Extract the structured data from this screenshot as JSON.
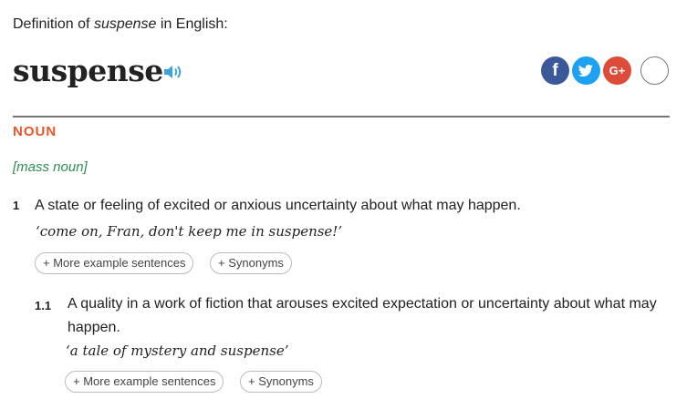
{
  "header": {
    "definition_of_prefix": "Definition of",
    "definition_of_word": "suspense",
    "definition_of_suffix": "in English:"
  },
  "entry": {
    "headword": "suspense",
    "part_of_speech": "NOUN",
    "grammar_note": "[mass noun]"
  },
  "share": {
    "facebook_label": "f",
    "googleplus_label": "G+",
    "more_label": "+"
  },
  "senses": [
    {
      "number": "1",
      "definition": "A state or feeling of excited or anxious uncertainty about what may happen.",
      "example": "‘come on, Fran, don't keep me in suspense!’",
      "more_examples_label": "+ More example sentences",
      "synonyms_label": "+ Synonyms"
    },
    {
      "number": "1.1",
      "definition": "A quality in a work of fiction that arouses excited expectation or uncertainty about what may happen.",
      "example": "‘a tale of mystery and suspense’",
      "more_examples_label": "+ More example sentences",
      "synonyms_label": "+ Synonyms"
    }
  ],
  "colors": {
    "part_of_speech": "#e8552a",
    "grammar_note": "#2e8b57",
    "facebook": "#3b5998",
    "twitter": "#1da1f2",
    "googleplus": "#dd4b39"
  },
  "icons": {
    "pronunciation": "speaker-icon",
    "twitter": "twitter-bird-icon"
  }
}
